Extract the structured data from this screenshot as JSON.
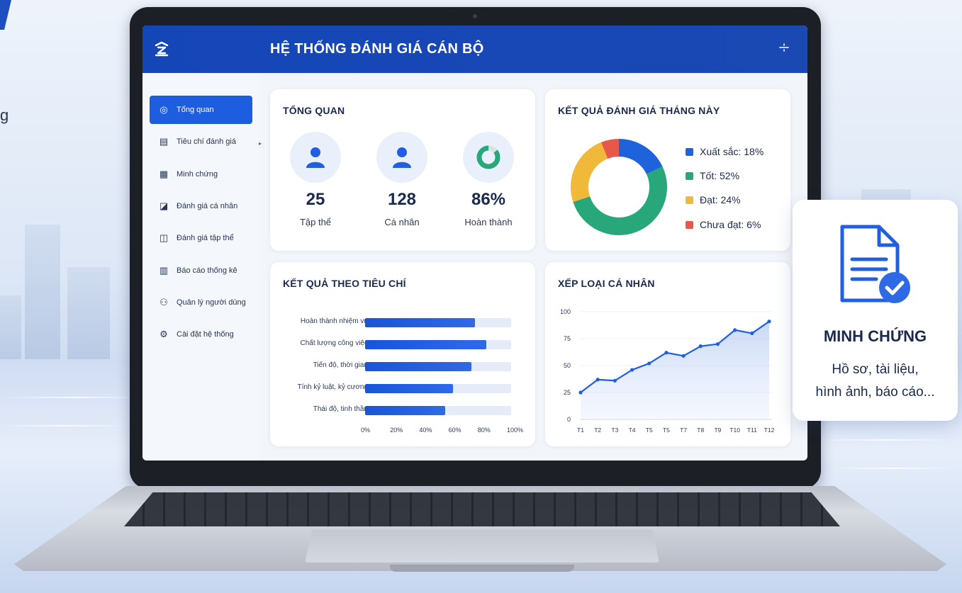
{
  "app": {
    "title": "HỆ THỐNG ĐÁNH GIÁ CÁN BỘ"
  },
  "sidebar": {
    "items": [
      {
        "label": "Tổng quan",
        "icon": "dashboard-icon",
        "active": true
      },
      {
        "label": "Tiêu chí đánh giá",
        "icon": "criteria-icon",
        "active": false
      },
      {
        "label": "Minh chứng",
        "icon": "evidence-icon",
        "active": false
      },
      {
        "label": "Đánh giá cá nhân",
        "icon": "personal-review-icon",
        "active": false
      },
      {
        "label": "Đánh giá tập thể",
        "icon": "team-review-icon",
        "active": false
      },
      {
        "label": "Báo cáo thống kê",
        "icon": "report-icon",
        "active": false
      },
      {
        "label": "Quản lý người dùng",
        "icon": "users-icon",
        "active": false
      },
      {
        "label": "Cài đặt hệ thống",
        "icon": "settings-icon",
        "active": false
      }
    ]
  },
  "overview": {
    "title": "TỔNG QUAN",
    "stats": [
      {
        "value": "25",
        "label": "Tập thể",
        "icon": "group-icon"
      },
      {
        "value": "128",
        "label": "Cá nhân",
        "icon": "person-icon"
      },
      {
        "value": "86%",
        "label": "Hoàn thành",
        "icon": "progress-ring-icon"
      }
    ]
  },
  "monthly": {
    "title": "KẾT QUẢ ĐÁNH GIÁ THÁNG NÀY",
    "legend": [
      "Xuất sắc: 18%",
      "Tốt: 52%",
      "Đạt: 24%",
      "Chưa đạt: 6%"
    ]
  },
  "criteria": {
    "title": "KẾT QUẢ THEO TIÊU CHÍ"
  },
  "ranking": {
    "title": "XẾP LOẠI CÁ NHÂN"
  },
  "evidence_card": {
    "title": "MINH CHỨNG",
    "line1": "Hồ sơ, tài liệu,",
    "line2": "hình ảnh, báo cáo..."
  },
  "colors": {
    "primary": "#1a49b4",
    "excellent": "#1f63dc",
    "good": "#27a77a",
    "pass": "#f0b93a",
    "fail": "#e5584a",
    "grey": "#b7b7b7"
  },
  "chart_data": [
    {
      "type": "pie",
      "title": "KẾT QUẢ ĐÁNH GIÁ THÁNG NÀY",
      "categories": [
        "Xuất sắc",
        "Tốt",
        "Đạt",
        "Chưa đạt"
      ],
      "values": [
        18,
        52,
        24,
        6
      ],
      "colors": [
        "#1f63dc",
        "#27a77a",
        "#f0b93a",
        "#e5584a"
      ],
      "legend": "right"
    },
    {
      "type": "bar",
      "orientation": "horizontal",
      "title": "KẾT QUẢ THEO TIÊU CHÍ",
      "categories": [
        "Hoàn thành nhiệm vụ",
        "Chất lượng công việc",
        "Tiến độ, thời gian",
        "Tính kỷ luật, kỷ cương",
        "Thái độ, tinh thần"
      ],
      "values": [
        75,
        83,
        73,
        60,
        55
      ],
      "xlim": [
        0,
        100
      ],
      "xticks": [
        "0%",
        "20%",
        "40%",
        "60%",
        "80%",
        "100%"
      ]
    },
    {
      "type": "area",
      "title": "XẾP LOẠI CÁ NHÂN",
      "x": [
        "T1",
        "T2",
        "T3",
        "T4",
        "T5",
        "T5",
        "T7",
        "T8",
        "T9",
        "T10",
        "T11",
        "T12"
      ],
      "values": [
        25,
        37,
        36,
        46,
        52,
        62,
        59,
        68,
        70,
        83,
        80,
        91
      ],
      "ylim": [
        0,
        100
      ],
      "yticks": [
        "0",
        "25",
        "50",
        "75",
        "100"
      ]
    }
  ]
}
